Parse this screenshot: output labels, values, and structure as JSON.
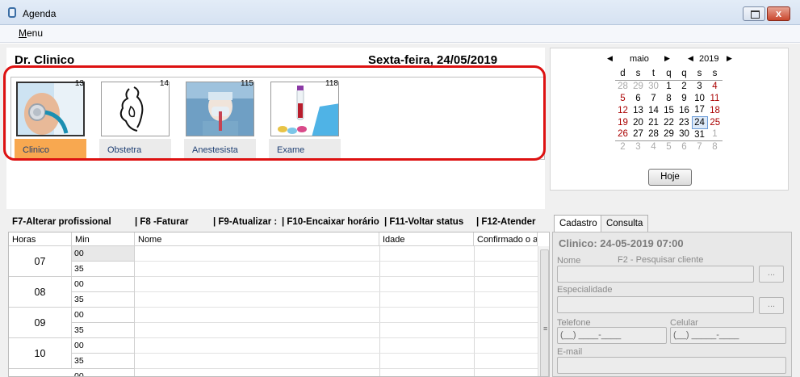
{
  "window": {
    "title": "Agenda",
    "close_label": "x"
  },
  "menubar": {
    "items": [
      {
        "label": "Menu"
      }
    ]
  },
  "header": {
    "doctor": "Dr. Clinico",
    "date": "Sexta-feira, 24/05/2019"
  },
  "specialties": [
    {
      "label": "Clinico",
      "count": "13",
      "icon": "stethoscope-image",
      "selected": true
    },
    {
      "label": "Obstetra",
      "count": "14",
      "icon": "pregnancy-sketch-image",
      "selected": false
    },
    {
      "label": "Anestesista",
      "count": "115",
      "icon": "anesthetist-image",
      "selected": false
    },
    {
      "label": "Exame",
      "count": "118",
      "icon": "blood-tubes-image",
      "selected": false
    }
  ],
  "calendar": {
    "month": "maio",
    "year": "2019",
    "weekdays": [
      "d",
      "s",
      "t",
      "q",
      "q",
      "s",
      "s"
    ],
    "weeks": [
      [
        "28",
        "29",
        "30",
        "1",
        "2",
        "3",
        "4"
      ],
      [
        "5",
        "6",
        "7",
        "8",
        "9",
        "10",
        "11"
      ],
      [
        "12",
        "13",
        "14",
        "15",
        "16",
        "17",
        "18"
      ],
      [
        "19",
        "20",
        "21",
        "22",
        "23",
        "24",
        "25"
      ],
      [
        "26",
        "27",
        "28",
        "29",
        "30",
        "31",
        "1"
      ],
      [
        "2",
        "3",
        "4",
        "5",
        "6",
        "7",
        "8"
      ]
    ],
    "selected_day": "24",
    "today_label": "Hoje"
  },
  "shortcuts": [
    "F7-Alterar profissional",
    "| F8 -Faturar",
    "| F9-Atualizar :",
    "| F10-Encaixar horário",
    "| F11-Voltar status",
    "| F12-Atender"
  ],
  "schedule": {
    "columns": [
      "Horas",
      "Min",
      "Nome",
      "Idade",
      "Confirmado o av"
    ],
    "hours": [
      "07",
      "08",
      "09",
      "10"
    ],
    "minutes": [
      "00",
      "35"
    ],
    "trailing_minute": "00"
  },
  "tabs": [
    {
      "label": "Cadastro",
      "active": true
    },
    {
      "label": "Consulta",
      "active": false
    }
  ],
  "form": {
    "title": "Clinico: 24-05-2019 07:00",
    "nome_label": "Nome",
    "nome_hint": "F2 - Pesquisar cliente",
    "especialidade_label": "Especialidade",
    "browse_label": "...",
    "telefone_label": "Telefone",
    "telefone_mask": "(__) ____-____",
    "celular_label": "Celular",
    "celular_mask": "(__) _____-____",
    "email_label": "E-mail"
  }
}
